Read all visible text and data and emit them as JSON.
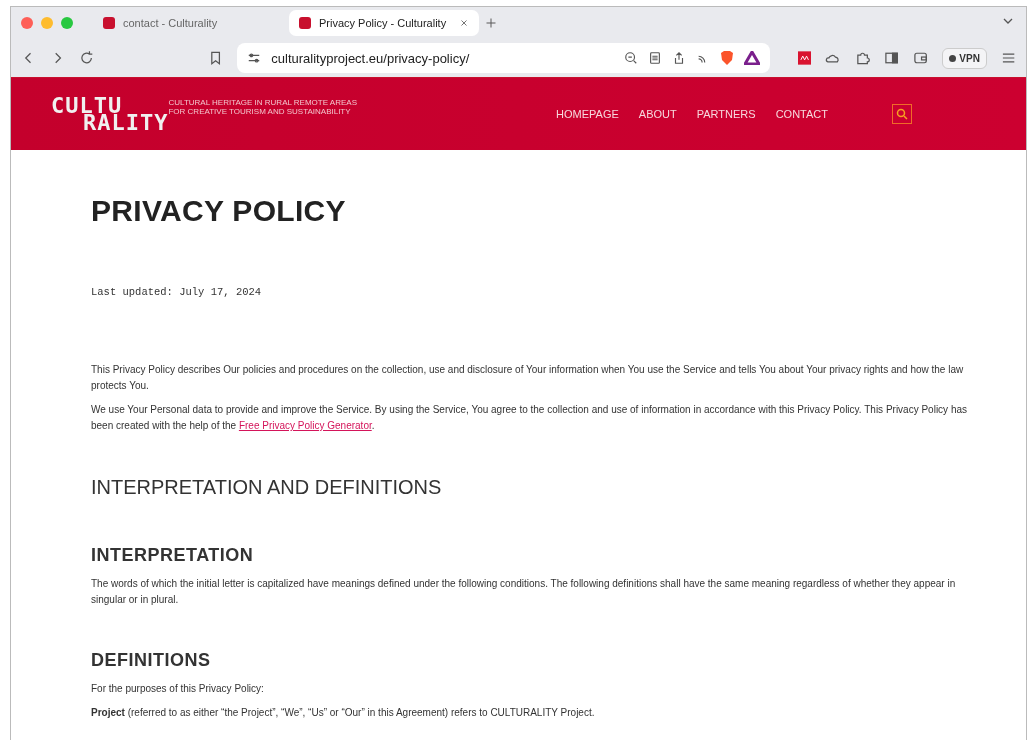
{
  "browser": {
    "tabs": [
      {
        "title": "contact - Culturality",
        "selected": false
      },
      {
        "title": "Privacy Policy - Culturality",
        "selected": true
      }
    ],
    "address": "culturalityproject.eu/privacy-policy/",
    "vpn_label": "VPN"
  },
  "header": {
    "logo_lines": [
      "CULTU",
      "RALITY"
    ],
    "tagline": [
      "CULTURAL HERITAGE IN RURAL REMOTE AREAS",
      "FOR CREATIVE TOURISM AND SUSTAINABILITY"
    ],
    "nav": [
      "HOMEPAGE",
      "ABOUT",
      "PARTNERS",
      "CONTACT"
    ]
  },
  "content": [
    {
      "kind": "title",
      "text": "PRIVACY POLICY"
    },
    {
      "kind": "mono",
      "text": "Last updated: July 17, 2024"
    },
    {
      "kind": "para",
      "text": "This Privacy Policy describes Our policies and procedures on the collection, use and disclosure of Your information when You use the Service and tells You about Your privacy rights and how the law protects You."
    },
    {
      "kind": "linkpara",
      "text": "We use Your Personal data to provide and improve the Service. By using the Service, You agree to the collection and use of information in accordance with this Privacy Policy. This Privacy Policy has been created with the help of the",
      "link": "Free Privacy Policy Generator",
      "after": "."
    },
    {
      "kind": "h2",
      "text": "INTERPRETATION AND DEFINITIONS"
    },
    {
      "kind": "h3",
      "text": "INTERPRETATION"
    },
    {
      "kind": "para",
      "text": "The words of which the initial letter is capitalized have meanings defined under the following conditions. The following definitions shall have the same meaning regardless of whether they appear in singular or in plural."
    },
    {
      "kind": "h3",
      "text": "DEFINITIONS"
    },
    {
      "kind": "para",
      "text": "For the purposes of this Privacy Policy:"
    },
    {
      "kind": "para",
      "text": "**Project** (referred to as either “the Project”, “We”, “Us” or “Our” in this Agreement) refers to CULTURALITY Project."
    }
  ]
}
